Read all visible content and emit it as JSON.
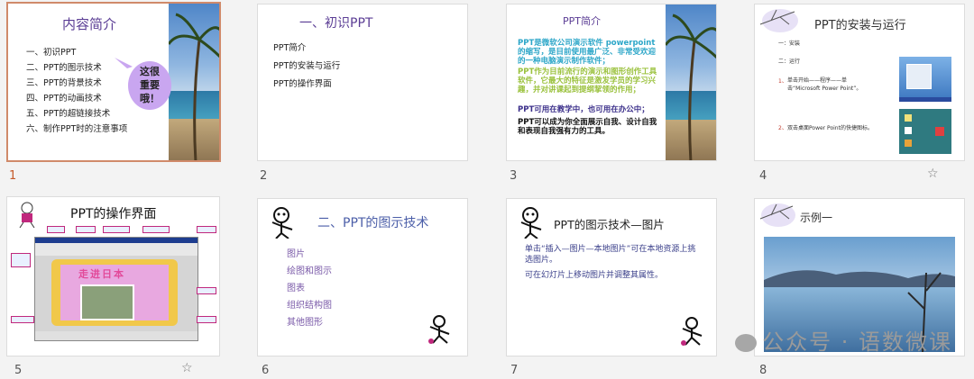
{
  "slides": [
    {
      "number": "1",
      "title": "内容简介",
      "items": [
        "一、初识PPT",
        "二、PPT的图示技术",
        "三、PPT的背景技术",
        "四、PPT的动画技术",
        "五、PPT的超链接技术",
        "六、制作PPT时的注意事项"
      ],
      "bubble": [
        "这很",
        "重要",
        "哦！"
      ]
    },
    {
      "number": "2",
      "title": "一、初识PPT",
      "items": [
        "PPT简介",
        "PPT的安装与运行",
        "PPT的操作界面"
      ]
    },
    {
      "number": "3",
      "title": "PPT简介",
      "paragraphs": [
        {
          "text": "PPT是微软公司演示软件 powerpoint 的缩写，是目前使用最广泛、非常受欢迎的一种电脑演示制作软件；",
          "color": "#2ca6c8"
        },
        {
          "text": "PPT作为目前流行的演示和图形创作工具软件，它最大的特征是激发学员的学习兴趣，并对讲课起到提纲挈领的作用；",
          "color": "#9ac13c"
        },
        {
          "text": "PPT可用在教学中，也可用在办公中；",
          "color": "#3b2f8a"
        },
        {
          "text": "PPT可以成为你全面展示自我、设计自我和表现自我强有力的工具。",
          "color": "#111111"
        }
      ]
    },
    {
      "number": "4",
      "title": "PPT的安装与运行",
      "line1": "一：安装",
      "line2": "二：运行",
      "step1_num": "1、",
      "step1": "单击开始——程序——单击“Microsoft Power Point”。",
      "step2_num": "2、",
      "step2": "双击桌面Power Point的快捷图标。"
    },
    {
      "number": "5",
      "title": "PPT的操作界面",
      "banner": "走进日本"
    },
    {
      "number": "6",
      "title": "二、PPT的图示技术",
      "items": [
        "图片",
        "绘图和图示",
        "图表",
        "组织结构图",
        "其他图形"
      ]
    },
    {
      "number": "7",
      "title": "PPT的图示技术—图片",
      "line1": "单击“插入—图片—本地图片”可在本地资源上挑选图片。",
      "line2": "可在幻灯片上移动图片并调整其属性。"
    },
    {
      "number": "8",
      "title": "示例一"
    }
  ],
  "watermark": "公众号 · 语数微课",
  "colors": {
    "selected_border": "#d08a6a",
    "title_purple": "#5a3c94",
    "link_purple": "#7a5aa8",
    "bubble": "#c9a6f0"
  },
  "icons": {
    "star": "☆"
  }
}
